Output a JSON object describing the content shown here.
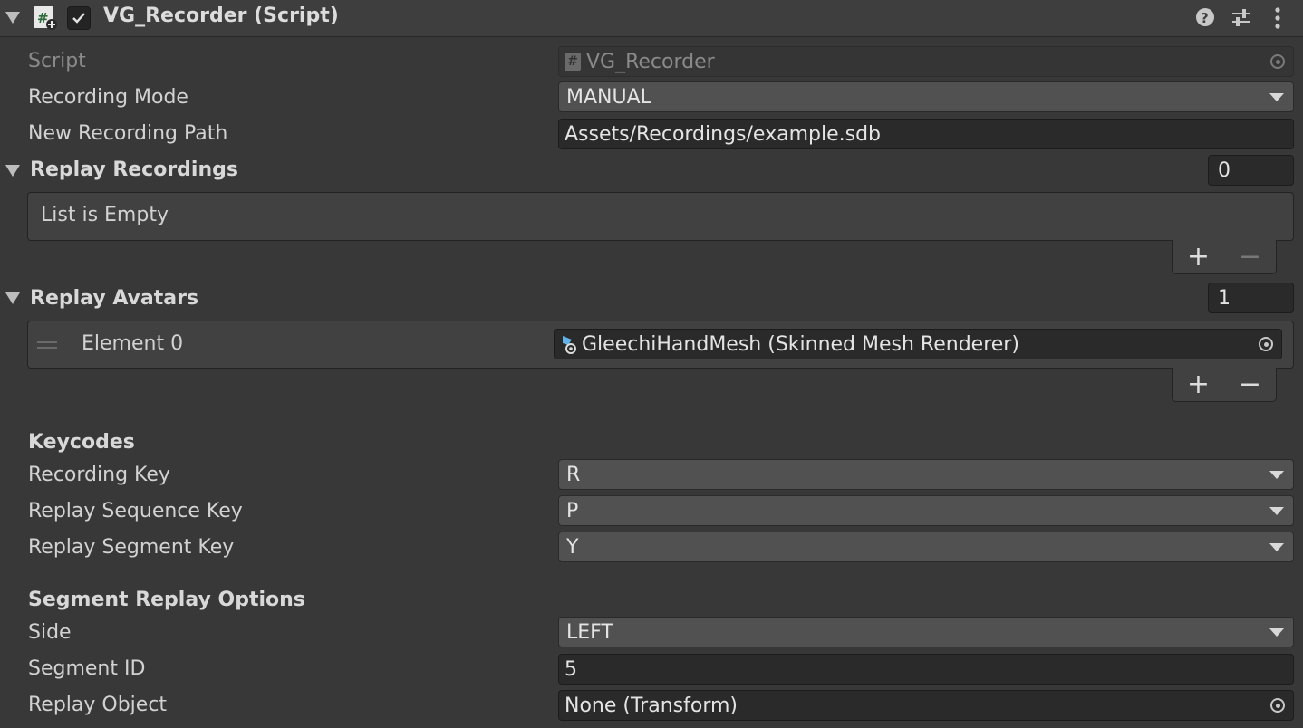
{
  "header": {
    "title": "VG_Recorder (Script)",
    "help_icon": "question-circle-icon",
    "presets_icon": "sliders-icon",
    "menu_icon": "kebab-menu-icon"
  },
  "fields": {
    "script": {
      "label": "Script",
      "value": "VG_Recorder"
    },
    "recording_mode": {
      "label": "Recording Mode",
      "value": "MANUAL"
    },
    "new_recording_path": {
      "label": "New Recording Path",
      "value": "Assets/Recordings/example.sdb"
    }
  },
  "replay_recordings": {
    "label": "Replay Recordings",
    "size": "0",
    "empty_text": "List is Empty"
  },
  "replay_avatars": {
    "label": "Replay Avatars",
    "size": "1",
    "elements": [
      {
        "label": "Element 0",
        "value": "GleechiHandMesh (Skinned Mesh Renderer)"
      }
    ]
  },
  "keycodes": {
    "header": "Keycodes",
    "recording_key": {
      "label": "Recording Key",
      "value": "R"
    },
    "replay_sequence_key": {
      "label": "Replay Sequence Key",
      "value": "P"
    },
    "replay_segment_key": {
      "label": "Replay Segment Key",
      "value": "Y"
    }
  },
  "segment_replay_options": {
    "header": "Segment Replay Options",
    "side": {
      "label": "Side",
      "value": "LEFT"
    },
    "segment_id": {
      "label": "Segment ID",
      "value": "5"
    },
    "replay_object": {
      "label": "Replay Object",
      "value": "None (Transform)"
    }
  },
  "list_buttons": {
    "plus": "+",
    "minus": "−"
  }
}
